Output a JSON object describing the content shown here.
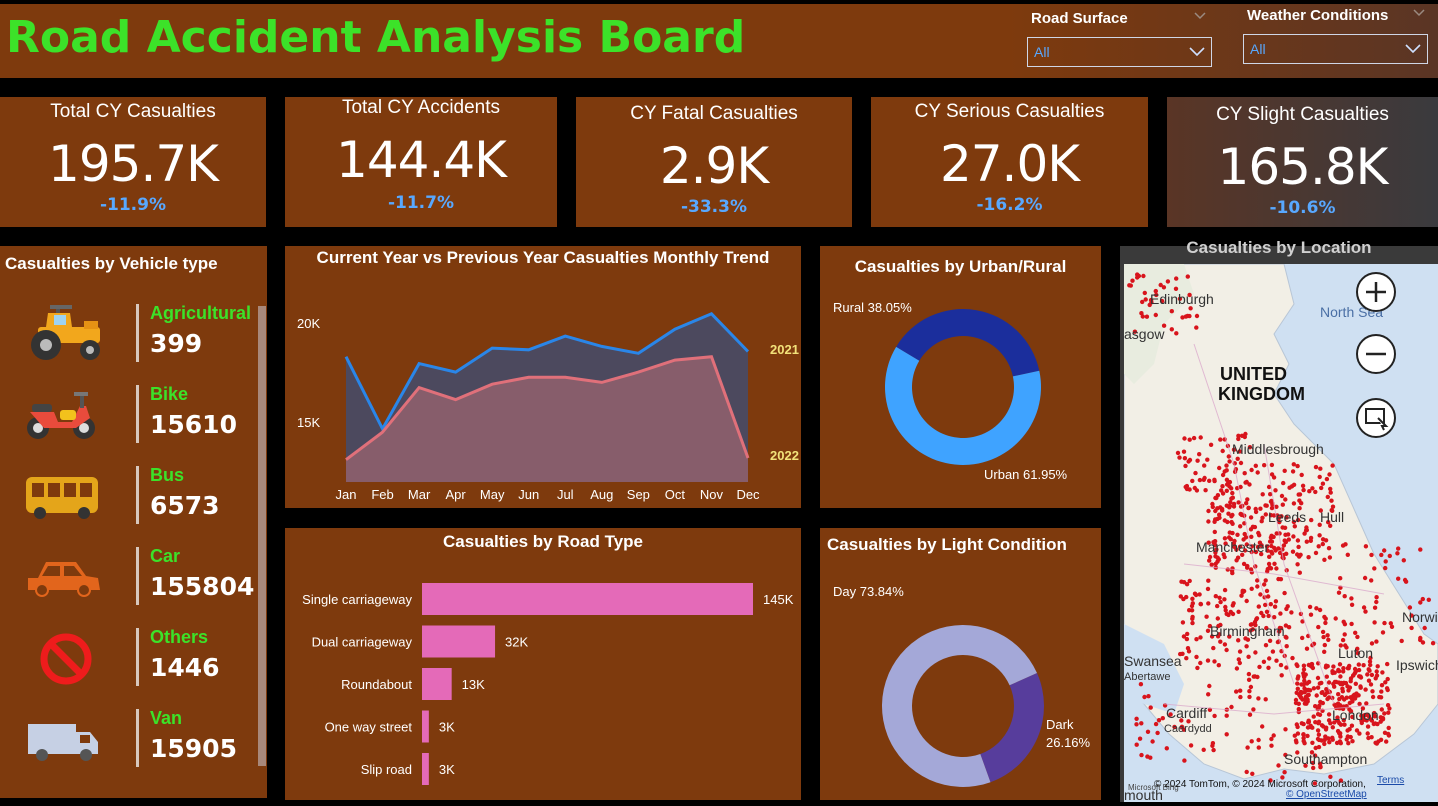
{
  "header": {
    "title": "Road Accident Analysis Board",
    "title_color": "#3ce229",
    "background": "#7e3a0d"
  },
  "slicers": [
    {
      "label": "Road Surface",
      "value": "All"
    },
    {
      "label": "Weather Conditions",
      "value": "All"
    }
  ],
  "kpis": [
    {
      "title": "Total CY Casualties",
      "value": "195.7K",
      "delta": "-11.9%"
    },
    {
      "title": "Total CY Accidents",
      "value": "144.4K",
      "delta": "-11.7%"
    },
    {
      "title": "CY Fatal Casualties",
      "value": "2.9K",
      "delta": "-33.3%"
    },
    {
      "title": "CY Serious Casualties",
      "value": "27.0K",
      "delta": "-16.2%"
    },
    {
      "title": "CY Slight Casualties",
      "value": "165.8K",
      "delta": "-10.6%"
    }
  ],
  "vehicles": {
    "title": "Casualties by Vehicle type",
    "items": [
      {
        "name": "Agricultural",
        "value": "399",
        "icon": "tractor-icon"
      },
      {
        "name": "Bike",
        "value": "15610",
        "icon": "motorbike-icon"
      },
      {
        "name": "Bus",
        "value": "6573",
        "icon": "bus-icon"
      },
      {
        "name": "Car",
        "value": "155804",
        "icon": "car-icon"
      },
      {
        "name": "Others",
        "value": "1446",
        "icon": "no-entry-icon"
      },
      {
        "name": "Van",
        "value": "15905",
        "icon": "van-icon"
      }
    ]
  },
  "trend": {
    "title": "Current Year vs Previous Year Casualties Monthly Trend",
    "y_ticks": [
      "20K",
      "15K"
    ],
    "months": [
      "Jan",
      "Feb",
      "Mar",
      "Apr",
      "May",
      "Jun",
      "Jul",
      "Aug",
      "Sep",
      "Oct",
      "Nov",
      "Dec"
    ],
    "series_labels": [
      "2021",
      "2022"
    ]
  },
  "urban": {
    "title": "Casualties by Urban/Rural",
    "labels": [
      "Rural 38.05%",
      "Urban 61.95%"
    ]
  },
  "roadtype": {
    "title": "Casualties by Road Type",
    "value_labels": [
      "145K",
      "32K",
      "13K",
      "3K",
      "3K"
    ]
  },
  "light": {
    "title": "Casualties by Light Condition",
    "label_day": "Day 73.84%",
    "label_dark_1": "Dark",
    "label_dark_2": "26.16%"
  },
  "map": {
    "title": "Casualties by Location",
    "labels": [
      "Edinburgh",
      "North Sea",
      "asgow",
      "UNITED",
      "KINGDOM",
      "Middlesbrough",
      "Leeds",
      "Hull",
      "Manchester",
      "Birmingham",
      "Norwi",
      "Swansea",
      "Abertawe",
      "Luton",
      "Ipswich",
      "Cardiff",
      "Caerdydd",
      "London",
      "Southampton",
      "mouth"
    ],
    "copyright": "© 2024 TomTom, © 2024 Microsoft Corporation,",
    "terms": "Terms",
    "osm": "© OpenStreetMap",
    "brand": "Microsoft Bing"
  },
  "chart_data": [
    {
      "type": "area",
      "title": "Current Year vs Previous Year Casualties Monthly Trend",
      "x": [
        "Jan",
        "Feb",
        "Mar",
        "Apr",
        "May",
        "Jun",
        "Jul",
        "Aug",
        "Sep",
        "Oct",
        "Nov",
        "Dec"
      ],
      "ylim": [
        11000,
        23000
      ],
      "y_ticks": [
        15000,
        20000
      ],
      "series": [
        {
          "name": "2021",
          "color": "#2a86e8",
          "values": [
            18300,
            14100,
            17900,
            17400,
            18800,
            18700,
            19500,
            18900,
            18500,
            19900,
            20800,
            18600
          ]
        },
        {
          "name": "2022",
          "color": "#e0707a",
          "values": [
            12300,
            13900,
            16500,
            15800,
            16700,
            17100,
            17100,
            16800,
            17400,
            18100,
            18300,
            12400
          ]
        }
      ]
    },
    {
      "type": "pie",
      "title": "Casualties by Urban/Rural",
      "categories": [
        "Rural",
        "Urban"
      ],
      "values": [
        38.05,
        61.95
      ],
      "colors": [
        "#1b2e9c",
        "#3fa3ff"
      ]
    },
    {
      "type": "bar",
      "title": "Casualties by Road Type",
      "categories": [
        "Single carriageway",
        "Dual carriageway",
        "Roundabout",
        "One way street",
        "Slip road"
      ],
      "values": [
        145000,
        32000,
        13000,
        3000,
        3000
      ],
      "color": "#e46ab8"
    },
    {
      "type": "pie",
      "title": "Casualties by Light Condition",
      "categories": [
        "Day",
        "Dark"
      ],
      "values": [
        73.84,
        26.16
      ],
      "colors": [
        "#a4a8d8",
        "#573d9c"
      ]
    }
  ]
}
